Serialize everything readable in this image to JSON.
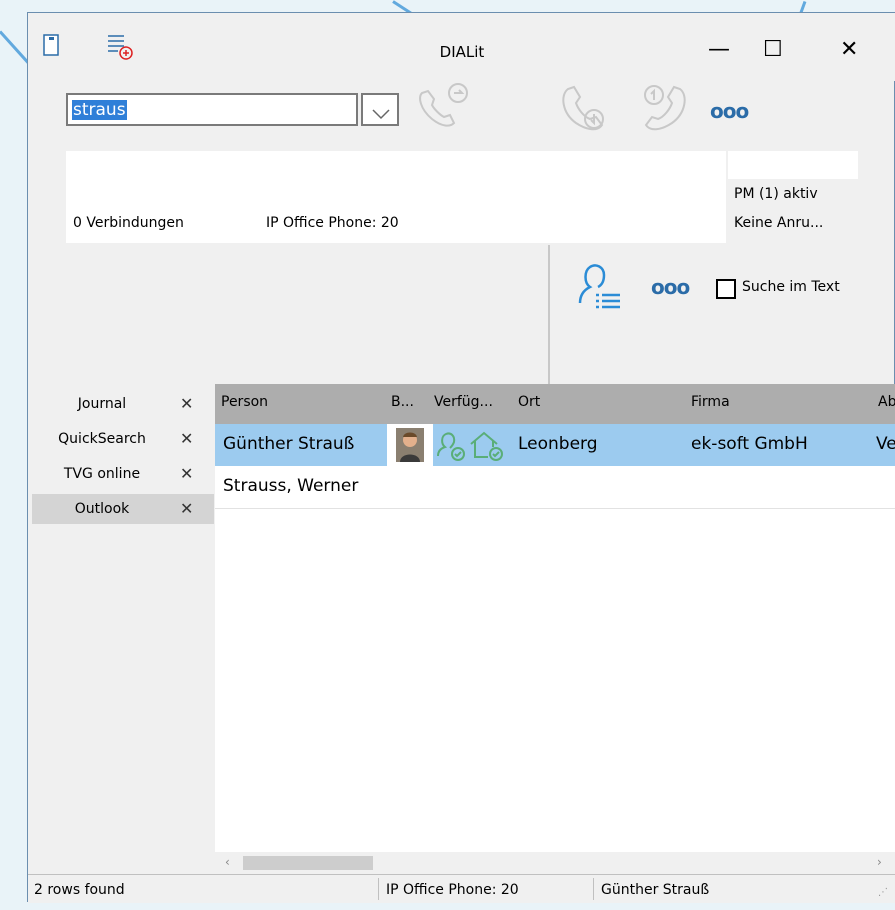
{
  "window": {
    "title": "DIALit",
    "minimize_glyph": "—",
    "maximize_glyph": "☐",
    "close_glyph": "✕"
  },
  "search": {
    "value": "straus"
  },
  "toolbar": {
    "more_label": "ooo"
  },
  "info": {
    "connections": "0 Verbindungen",
    "phone_status": "IP Office Phone: 20",
    "pm_status": "PM (1) aktiv",
    "calls_status": "Keine Anru..."
  },
  "contact_search": {
    "more_label": "ooo",
    "search_in_text_label": "Suche im Text"
  },
  "tabs": [
    {
      "label": "Journal",
      "close": "✕"
    },
    {
      "label": "QuickSearch",
      "close": "✕"
    },
    {
      "label": "TVG online",
      "close": "✕"
    },
    {
      "label": "Outlook",
      "close": "✕"
    }
  ],
  "grid": {
    "columns": [
      "Person",
      "B...",
      "Verfüg...",
      "Ort",
      "Firma",
      "Ab"
    ],
    "rows": [
      {
        "person": "Günther Strauß",
        "ort": "Leonberg",
        "firma": "ek-soft GmbH",
        "ab": "Ve"
      },
      {
        "person": "Strauss, Werner",
        "ort": "",
        "firma": "",
        "ab": ""
      }
    ]
  },
  "status": {
    "rows_found": "2 rows found",
    "phone": "IP Office Phone: 20",
    "user": "Günther Strauß"
  },
  "colors": {
    "accent": "#62a9de",
    "selected_row": "#9ccbef",
    "grid_header": "#adadad",
    "icon_green": "#5aae78"
  }
}
